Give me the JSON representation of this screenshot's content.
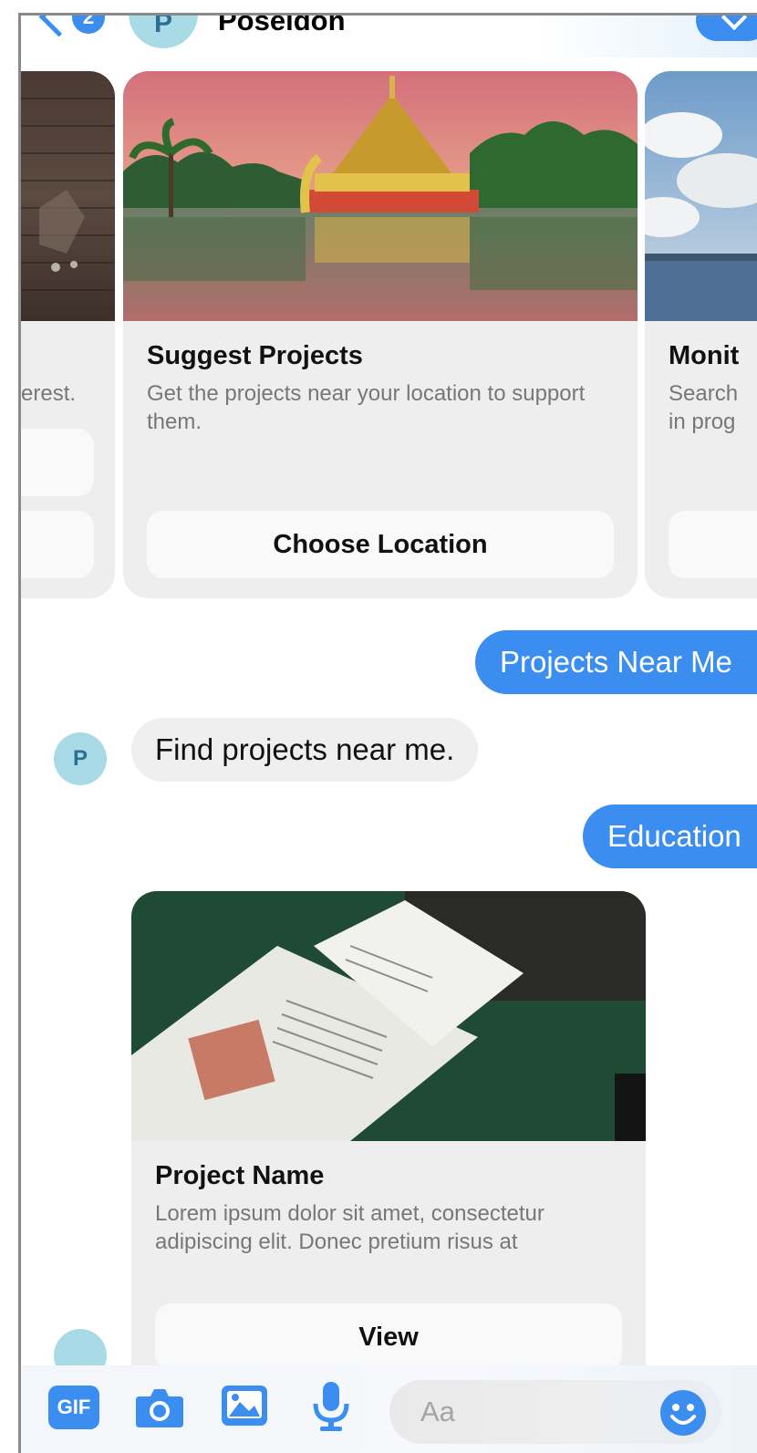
{
  "header": {
    "back_badge": "2",
    "avatar_initial": "P",
    "name": "Poseidon"
  },
  "carousel": {
    "left_card": {
      "desc_fragment": "erest."
    },
    "center_card": {
      "title": "Suggest Projects",
      "description": "Get the projects near your location to support them.",
      "button_label": "Choose Location"
    },
    "right_card": {
      "title_fragment": "Monit",
      "desc_fragment_1": "Search",
      "desc_fragment_2": "in prog"
    }
  },
  "messages": [
    {
      "from": "user",
      "text": "Projects Near Me"
    },
    {
      "from": "bot",
      "avatar_initial": "P",
      "text": "Find projects near me."
    },
    {
      "from": "user",
      "text": "Education"
    }
  ],
  "project_card": {
    "title": "Project Name",
    "description": "Lorem ipsum dolor sit amet, consectetur adipiscing elit. Donec pretium risus at",
    "button_label": "View"
  },
  "composer": {
    "gif_label": "GIF",
    "placeholder": "Aa",
    "icons": [
      "gif-icon",
      "camera-icon",
      "image-icon",
      "microphone-icon",
      "emoji-icon"
    ]
  },
  "colors": {
    "accent": "#3b8df0",
    "avatar_bg": "#a9dbe6",
    "bubble_in_bg": "#efefef",
    "card_bg": "#eeeeee"
  }
}
